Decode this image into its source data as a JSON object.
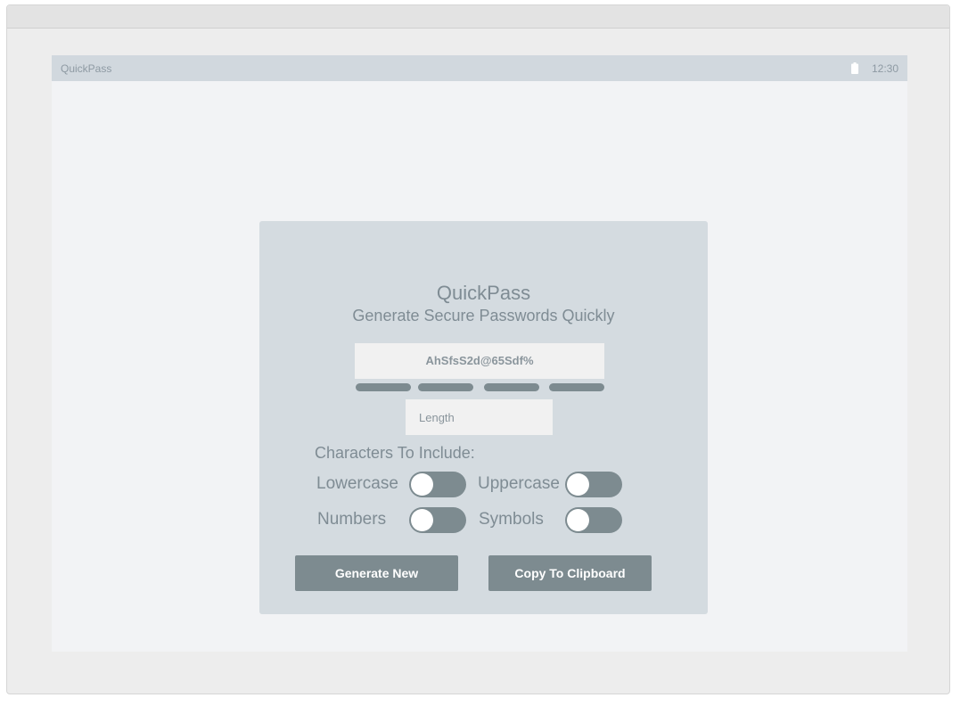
{
  "status_bar": {
    "app_name": "QuickPass",
    "battery_icon": "battery-icon",
    "time": "12:30"
  },
  "card": {
    "title": "QuickPass",
    "subtitle": "Generate Secure Passwords Quickly",
    "password": "AhSfsS2d@65Sdf%",
    "strength_segments": 4,
    "length_placeholder": "Length",
    "characters_label": "Characters To Include:",
    "options": {
      "lowercase": {
        "label": "Lowercase",
        "on": false
      },
      "uppercase": {
        "label": "Uppercase",
        "on": false
      },
      "numbers": {
        "label": "Numbers",
        "on": false
      },
      "symbols": {
        "label": "Symbols",
        "on": false
      }
    },
    "generate_label": "Generate New",
    "copy_label": "Copy To Clipboard"
  },
  "colors": {
    "card_bg": "#d4dbe0",
    "accent": "#7d8b90",
    "text_muted": "#7f8c94",
    "status_bar_bg": "#d1d8de"
  }
}
